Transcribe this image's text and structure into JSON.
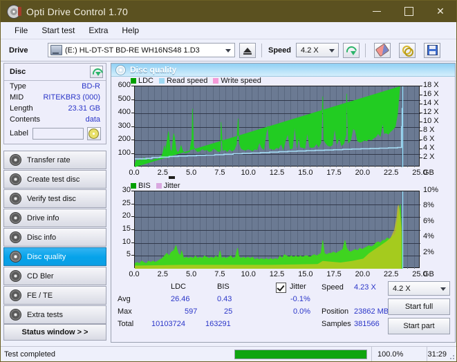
{
  "window": {
    "title": "Opti Drive Control 1.70",
    "icon": "disc-icon",
    "minimize": "minimize-icon",
    "maximize": "maximize-icon",
    "close": "close-icon"
  },
  "menu": {
    "items": [
      {
        "label": "File"
      },
      {
        "label": "Start test"
      },
      {
        "label": "Extra"
      },
      {
        "label": "Help"
      }
    ]
  },
  "toolbar": {
    "drive_label": "Drive",
    "drive_value": "(E:)  HL-DT-ST BD-RE  WH16NS48 1.D3",
    "eject_title": "eject-icon",
    "speed_label": "Speed",
    "speed_value": "4.2 X",
    "refresh_title": "refresh-icon",
    "erase_title": "erase-icon",
    "plug_title": "plug-icon",
    "save_title": "save-icon"
  },
  "disc_panel": {
    "title": "Disc",
    "refresh_title": "refresh-icon",
    "rows": [
      {
        "key": "Type",
        "value": "BD-R"
      },
      {
        "key": "MID",
        "value": "RITEKBR3 (000)"
      },
      {
        "key": "Length",
        "value": "23.31 GB"
      },
      {
        "key": "Contents",
        "value": "data"
      }
    ],
    "label_key": "Label",
    "label_value": "",
    "label_placeholder": ""
  },
  "sidebar": {
    "items": [
      {
        "label": "Transfer rate",
        "active": false
      },
      {
        "label": "Create test disc",
        "active": false
      },
      {
        "label": "Verify test disc",
        "active": false
      },
      {
        "label": "Drive info",
        "active": false
      },
      {
        "label": "Disc info",
        "active": false
      },
      {
        "label": "Disc quality",
        "active": true
      },
      {
        "label": "CD Bler",
        "active": false
      },
      {
        "label": "FE / TE",
        "active": false
      },
      {
        "label": "Extra tests",
        "active": false
      }
    ],
    "status_window": "Status window > >"
  },
  "content": {
    "title": "Disc quality"
  },
  "stats": {
    "col_ldc": "LDC",
    "col_bis": "BIS",
    "jitter_label": "Jitter",
    "jitter_checked": true,
    "rows": [
      {
        "name": "Avg",
        "ldc": "26.46",
        "bis": "0.43",
        "jitter": "-0.1%"
      },
      {
        "name": "Max",
        "ldc": "597",
        "bis": "25",
        "jitter": "0.0%"
      },
      {
        "name": "Total",
        "ldc": "10103724",
        "bis": "163291",
        "jitter": ""
      }
    ],
    "speed_label": "Speed",
    "speed_value": "4.23 X",
    "position_label": "Position",
    "position_value": "23862 MB",
    "samples_label": "Samples",
    "samples_value": "381566",
    "speed_select": "4.2 X",
    "start_full": "Start full",
    "start_part": "Start part"
  },
  "statusbar": {
    "text": "Test completed",
    "percent": "100.0%",
    "progress": 100,
    "elapsed": "31:29",
    "progress_color": "#10a510"
  },
  "chart_data": [
    {
      "type": "area",
      "id": "ldc-chart",
      "title": "LDC",
      "xlabel": "GB",
      "ylabel": "",
      "xlim": [
        0,
        25
      ],
      "ylim": [
        0,
        600
      ],
      "y2lim": [
        0,
        18
      ],
      "grid": true,
      "legend_position": "top-left",
      "legend": [
        {
          "name": "LDC",
          "color": "#00a000"
        },
        {
          "name": "Read speed",
          "color": "#9fd8f2"
        },
        {
          "name": "Write speed",
          "color": "#f59ad8"
        }
      ],
      "xticks": [
        "0.0",
        "2.5",
        "5.0",
        "7.5",
        "10.0",
        "12.5",
        "15.0",
        "17.5",
        "20.0",
        "22.5",
        "25.0"
      ],
      "yticks": [
        100,
        200,
        300,
        400,
        500,
        600
      ],
      "y2ticks": [
        "2 X",
        "4 X",
        "6 X",
        "8 X",
        "10 X",
        "12 X",
        "14 X",
        "16 X",
        "18 X"
      ],
      "xunit": "GB",
      "series": [
        {
          "name": "LDC",
          "color": "#22cc22",
          "x": [
            0.0,
            0.15,
            0.3,
            0.45,
            0.6,
            0.8,
            1.0,
            1.2,
            1.4,
            1.6,
            1.8,
            2.0,
            2.2,
            2.4,
            2.6,
            2.65,
            2.8,
            2.95,
            3.1,
            3.25,
            3.4,
            3.5,
            3.6,
            3.75,
            3.9,
            4.05,
            4.2,
            4.4,
            4.6,
            4.8,
            5.0,
            5.05,
            5.15,
            5.3,
            5.5,
            5.7,
            5.9,
            6.1,
            6.3,
            6.5,
            6.7,
            6.9,
            7.1,
            7.3,
            7.5,
            7.55,
            7.7,
            7.9,
            8.1,
            8.3,
            8.5,
            8.7,
            8.9,
            9.05,
            9.15,
            9.3,
            9.5,
            9.7,
            9.9,
            10.1,
            10.3,
            10.5,
            10.7,
            10.9,
            11.1,
            11.3,
            11.5,
            11.65,
            11.8,
            12.0,
            12.2,
            12.4,
            12.6,
            12.8,
            13.0,
            13.2,
            13.4,
            13.6,
            13.8,
            14.0,
            14.2,
            14.35,
            14.5,
            14.7,
            14.9,
            15.1,
            15.3,
            15.5,
            15.7,
            15.9,
            16.1,
            16.3,
            16.45,
            16.55,
            16.7,
            16.9,
            17.1,
            17.3,
            17.5,
            17.7,
            17.9,
            18.1,
            18.3,
            18.5,
            18.55,
            18.7,
            18.9,
            19.1,
            19.3,
            19.5,
            19.7,
            19.9,
            20.1,
            20.3,
            20.5,
            20.7,
            20.9,
            21.1,
            21.3,
            21.5,
            21.7,
            21.85,
            22.0,
            22.2,
            22.4,
            22.6,
            22.8,
            23.0,
            23.2,
            23.35,
            23.4
          ],
          "y": [
            20,
            55,
            48,
            62,
            45,
            70,
            52,
            60,
            48,
            55,
            62,
            58,
            75,
            90,
            160,
            110,
            180,
            265,
            130,
            115,
            250,
            210,
            130,
            110,
            120,
            160,
            120,
            105,
            110,
            115,
            215,
            435,
            150,
            130,
            115,
            120,
            135,
            125,
            130,
            115,
            120,
            140,
            130,
            115,
            120,
            335,
            125,
            130,
            115,
            135,
            120,
            130,
            170,
            360,
            180,
            140,
            130,
            125,
            135,
            130,
            120,
            135,
            130,
            185,
            145,
            130,
            255,
            305,
            140,
            135,
            130,
            145,
            140,
            175,
            130,
            200,
            250,
            135,
            140,
            310,
            145,
            230,
            150,
            145,
            140,
            260,
            150,
            145,
            150,
            175,
            150,
            185,
            525,
            200,
            180,
            160,
            155,
            165,
            295,
            170,
            220,
            160,
            175,
            240,
            545,
            180,
            200,
            285,
            275,
            195,
            185,
            190,
            200,
            195,
            210,
            200,
            215,
            225,
            250,
            230,
            330,
            250,
            255,
            245,
            265,
            280,
            300,
            395,
            600
          ]
        },
        {
          "name": "Read speed",
          "color": "#a5dcf5",
          "x": [
            0.0,
            1.0,
            1.5,
            2.2,
            3.0,
            3.8,
            4.6,
            5.4,
            6.2,
            7.0,
            7.8,
            8.6,
            9.4,
            10.2,
            11.0,
            11.8,
            12.6,
            13.4,
            14.2,
            15.0,
            15.8,
            16.6,
            17.4,
            18.2,
            19.0,
            19.8,
            20.6,
            21.4,
            22.2,
            23.0,
            23.3,
            23.35,
            23.4
          ],
          "y": [
            62,
            65,
            72,
            75,
            80,
            83,
            85,
            88,
            90,
            93,
            96,
            100,
            103,
            105,
            108,
            112,
            115,
            118,
            120,
            123,
            125,
            127,
            130,
            133,
            135,
            137,
            139,
            141,
            143,
            146,
            146,
            300,
            440
          ]
        }
      ]
    },
    {
      "type": "area",
      "id": "bis-chart",
      "title": "BIS",
      "xlabel": "GB",
      "ylabel": "",
      "xlim": [
        0,
        25
      ],
      "ylim": [
        0,
        30
      ],
      "y2lim": [
        0,
        10
      ],
      "grid": true,
      "legend_position": "top-left",
      "legend": [
        {
          "name": "BIS",
          "color": "#00a000"
        },
        {
          "name": "Jitter",
          "color": "#d9a8e0"
        }
      ],
      "xticks": [
        "0.0",
        "2.5",
        "5.0",
        "7.5",
        "10.0",
        "12.5",
        "15.0",
        "17.5",
        "20.0",
        "22.5",
        "25.0"
      ],
      "yticks": [
        5,
        10,
        15,
        20,
        25,
        30
      ],
      "y2ticks": [
        "2%",
        "4%",
        "6%",
        "8%",
        "10%"
      ],
      "xunit": "GB",
      "series": [
        {
          "name": "BIS",
          "color": "#3fd420",
          "x": [
            0.0,
            0.2,
            0.4,
            0.6,
            0.8,
            1.0,
            1.2,
            1.4,
            1.6,
            1.8,
            2.0,
            2.2,
            2.4,
            2.6,
            2.8,
            3.0,
            3.2,
            3.4,
            3.6,
            3.8,
            4.0,
            4.1,
            4.3,
            4.5,
            4.7,
            4.9,
            5.1,
            5.3,
            5.5,
            5.7,
            5.9,
            6.1,
            6.3,
            6.5,
            6.7,
            6.9,
            7.1,
            7.3,
            7.45,
            7.6,
            7.8,
            8.0,
            8.2,
            8.4,
            8.6,
            8.8,
            9.0,
            9.1,
            9.3,
            9.5,
            9.7,
            9.9,
            10.1,
            10.3,
            10.5,
            10.7,
            10.9,
            11.1,
            11.3,
            11.5,
            11.7,
            11.9,
            12.1,
            12.3,
            12.5,
            12.7,
            12.9,
            13.1,
            13.3,
            13.5,
            13.7,
            13.9,
            14.1,
            14.3,
            14.5,
            14.7,
            14.9,
            15.1,
            15.3,
            15.5,
            15.7,
            15.9,
            16.1,
            16.3,
            16.45,
            16.6,
            16.8,
            17.0,
            17.2,
            17.4,
            17.6,
            17.8,
            18.0,
            18.2,
            18.4,
            18.55,
            18.7,
            18.9,
            19.1,
            19.3,
            19.5,
            19.7,
            19.9,
            20.1,
            20.3,
            20.5,
            20.7,
            20.9,
            21.1,
            21.3,
            21.5,
            21.7,
            21.9,
            22.1,
            22.3,
            22.5,
            22.7,
            22.85,
            22.95,
            23.05,
            23.15,
            23.25,
            23.35,
            23.4
          ],
          "y": [
            2,
            2.5,
            2,
            3,
            2.5,
            2,
            3,
            2.5,
            3,
            2.5,
            3,
            3.5,
            4,
            5,
            6,
            5,
            6.5,
            7,
            9,
            6,
            5,
            7,
            4,
            4.5,
            4,
            4.5,
            4,
            5,
            4,
            4.5,
            4,
            5,
            4.5,
            4,
            4.5,
            4,
            5,
            4,
            7,
            4,
            4.5,
            4,
            4.5,
            5,
            4,
            4.5,
            8,
            5,
            4,
            4.5,
            4,
            4.5,
            4,
            4.5,
            3.5,
            4,
            3.5,
            4,
            3.5,
            4,
            3.5,
            4,
            3.5,
            4,
            3.5,
            5,
            4,
            5.5,
            5,
            4.5,
            5,
            4.5,
            5,
            4.5,
            5,
            4.5,
            5,
            5,
            4.5,
            5,
            5.5,
            5,
            5.5,
            6,
            11,
            6,
            5.5,
            6,
            6,
            6.5,
            6,
            6.5,
            7,
            7.5,
            11,
            8,
            7,
            6.5,
            7,
            7.5,
            7,
            8,
            7.5,
            8,
            8.5,
            9,
            8.5,
            9,
            10,
            10.5,
            10,
            11,
            11,
            12,
            11.5,
            12.5,
            13,
            14,
            17,
            20,
            22,
            25,
            16,
            8
          ]
        },
        {
          "name": "Jitter",
          "color": "#c8c81e",
          "x": [
            0.0,
            4.0,
            8.0,
            12.0,
            16.0,
            16.45,
            18.0,
            19.0,
            20.0,
            20.5,
            21.0,
            21.5,
            22.0,
            22.4,
            22.7,
            22.9,
            23.0,
            23.1,
            23.2,
            23.3,
            23.35
          ],
          "y": [
            0.4,
            0.5,
            0.5,
            0.5,
            0.6,
            1.0,
            0.8,
            1.0,
            1.3,
            2.0,
            2.5,
            3.0,
            3.5,
            4.0,
            5.0,
            6.5,
            8.0,
            8.3,
            7.5,
            6.0,
            5.0
          ]
        }
      ]
    }
  ]
}
